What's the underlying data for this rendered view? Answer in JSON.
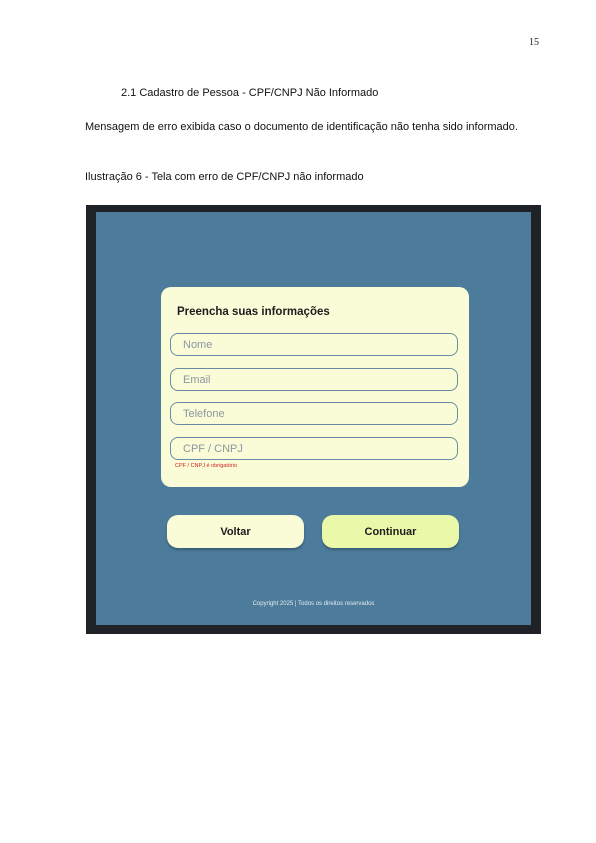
{
  "page": {
    "number": "15"
  },
  "section": {
    "heading": "2.1 Cadastro de Pessoa - CPF/CNPJ Não Informado"
  },
  "body": {
    "paragraph": "Mensagem de erro exibida caso o documento de identificação não tenha sido informado.",
    "caption": "Ilustração 6 - Tela com erro de CPF/CNPJ não informado"
  },
  "screen": {
    "form_title": "Preencha suas informações",
    "fields": [
      {
        "placeholder": "Nome"
      },
      {
        "placeholder": "Email"
      },
      {
        "placeholder": "Telefone"
      },
      {
        "placeholder": "CPF / CNPJ"
      }
    ],
    "error": "CPF / CNPJ é obrigatório",
    "back_label": "Voltar",
    "continue_label": "Continuar",
    "footer": "Copyright 2025 | Todos os direitos reservados",
    "colors": {
      "background": "#4c7b9b",
      "card": "#fafcd8",
      "continue_button": "#e9f8a9",
      "error": "#d0231f"
    }
  }
}
